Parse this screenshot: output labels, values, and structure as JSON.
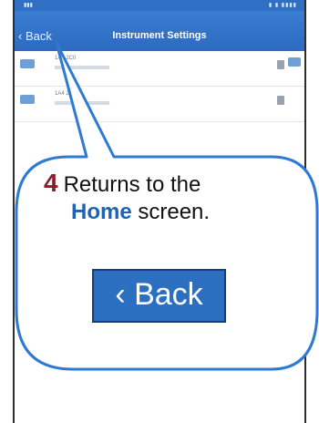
{
  "app": {
    "title": "Instrument Settings",
    "back_label": "‹ Back"
  },
  "instruments": [
    {
      "id": "1A4 2C0"
    },
    {
      "id": "1A4 2C4"
    }
  ],
  "callout": {
    "step_number": "4",
    "text_a": "Returns to the",
    "home_word": "Home",
    "text_b": "screen.",
    "back_button_label": "‹ Back"
  }
}
